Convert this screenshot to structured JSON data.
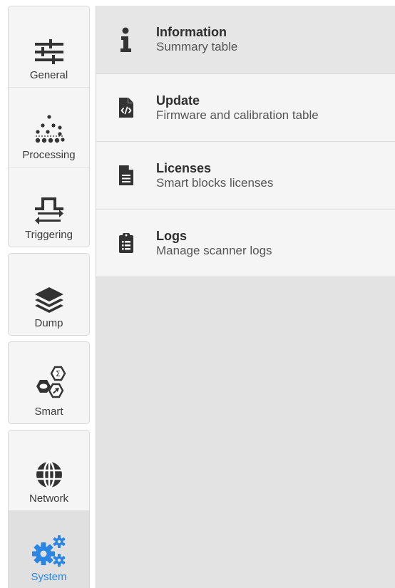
{
  "sidebar": {
    "items": [
      {
        "label": "General",
        "icon": "sliders-icon"
      },
      {
        "label": "Processing",
        "icon": "dots-icon"
      },
      {
        "label": "Triggering",
        "icon": "pulse-icon"
      },
      {
        "label": "Dump",
        "icon": "layers-icon"
      },
      {
        "label": "Smart",
        "icon": "smart-hex-icon"
      },
      {
        "label": "Network",
        "icon": "globe-icon"
      },
      {
        "label": "System",
        "icon": "gears-icon",
        "active": true
      }
    ]
  },
  "main": {
    "items": [
      {
        "title": "Information",
        "subtitle": "Summary table",
        "icon": "info-icon",
        "selected": true
      },
      {
        "title": "Update",
        "subtitle": "Firmware and calibration table",
        "icon": "code-file-icon"
      },
      {
        "title": "Licenses",
        "subtitle": "Smart blocks licenses",
        "icon": "document-icon"
      },
      {
        "title": "Logs",
        "subtitle": "Manage scanner logs",
        "icon": "clipboard-list-icon"
      }
    ]
  },
  "colors": {
    "accent": "#2b86e3",
    "icon": "#333333",
    "panel": "#e3e3e3",
    "list_bg": "#f5f5f5"
  }
}
